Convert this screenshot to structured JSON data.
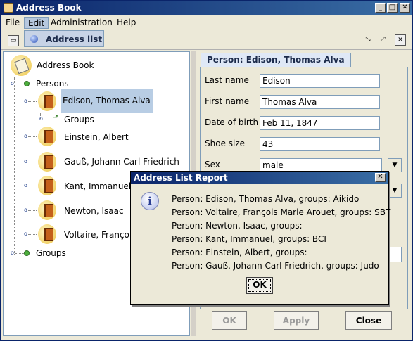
{
  "window": {
    "title": "Address Book",
    "controls": {
      "minimize": "_",
      "maximize": "□",
      "close": "✕"
    }
  },
  "menu": {
    "items": [
      "File",
      "Edit",
      "Administration",
      "Help"
    ],
    "dropdown": {
      "label": "Address list"
    }
  },
  "tree": {
    "root": "Address Book",
    "persons_label": "Persons",
    "persons": [
      "Edison, Thomas Alva",
      "Einstein, Albert",
      "Gauß, Johann Carl Friedrich",
      "Kant, Immanuel",
      "Newton, Isaac",
      "Voltaire, François"
    ],
    "sub_groups_label": "Groups",
    "groups_label": "Groups"
  },
  "detail": {
    "tab": "Person: Edison, Thomas Alva",
    "fields": [
      {
        "label": "Last name",
        "value": "Edison"
      },
      {
        "label": "First name",
        "value": "Thomas Alva"
      },
      {
        "label": "Date of birth",
        "value": "Feb 11, 1847"
      },
      {
        "label": "Shoe size",
        "value": "43"
      },
      {
        "label": "Sex",
        "value": "male"
      }
    ],
    "buttons": {
      "ok": "OK",
      "apply": "Apply",
      "close": "Close"
    }
  },
  "dialog": {
    "title": "Address List Report",
    "close": "✕",
    "icon": "i",
    "lines": [
      "Person: Edison, Thomas Alva, groups: Aikido",
      "Person: Voltaire, François Marie Arouet, groups: SBT",
      "Person: Newton, Isaac, groups:",
      "Person: Kant, Immanuel, groups: BCI",
      "Person: Einstein, Albert, groups:",
      "Person: Gauß, Johann Carl Friedrich, groups: Judo"
    ],
    "ok": "OK"
  }
}
